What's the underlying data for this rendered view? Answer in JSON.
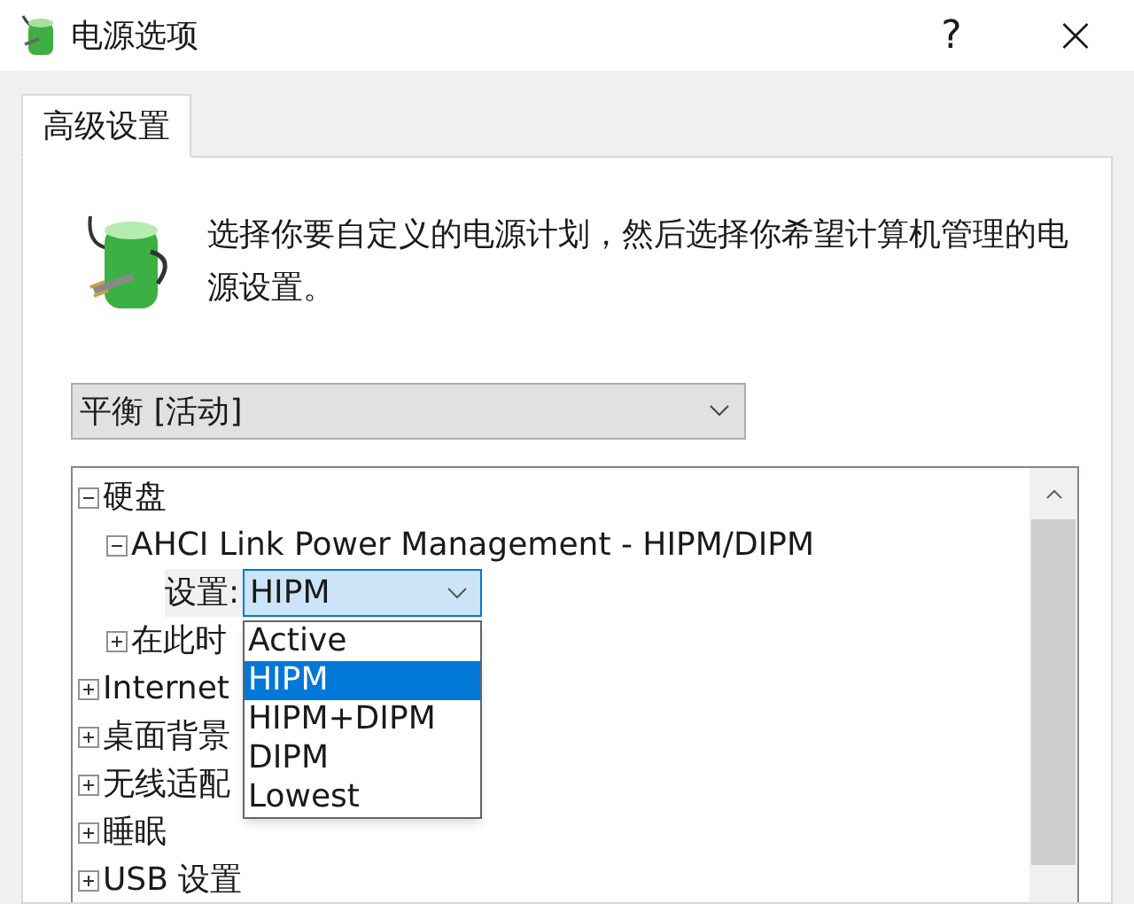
{
  "window": {
    "title": "电源选项",
    "buttons": [
      {
        "kind": "help",
        "label": "?"
      },
      {
        "kind": "close",
        "label": "×"
      }
    ]
  },
  "tabs": [
    {
      "label": "高级设置",
      "selected": true
    }
  ],
  "description": "选择你要自定义的电源计划，然后选择你希望计算机管理的电源设置。",
  "plan_dropdown": {
    "value": "平衡 [活动]"
  },
  "tree": [
    {
      "kind": "node",
      "label": "硬盘",
      "expanded": true,
      "children": [
        {
          "kind": "node",
          "label": "AHCI Link Power Management - HIPM/DIPM",
          "expanded": true,
          "children": [
            {
              "kind": "setting",
              "label": "设置:",
              "value": "HIPM",
              "open": true,
              "options": [
                {
                  "label": "Active",
                  "selected": false
                },
                {
                  "label": "HIPM",
                  "selected": true
                },
                {
                  "label": "HIPM+DIPM",
                  "selected": false
                },
                {
                  "label": "DIPM",
                  "selected": false
                },
                {
                  "label": "Lowest",
                  "selected": false
                }
              ]
            }
          ]
        },
        {
          "kind": "node",
          "label": "在此时",
          "expanded": false
        }
      ]
    },
    {
      "kind": "node",
      "label": "Internet",
      "expanded": false
    },
    {
      "kind": "node",
      "label": "桌面背景",
      "expanded": false
    },
    {
      "kind": "node",
      "label": "无线适配",
      "expanded": false
    },
    {
      "kind": "node",
      "label": "睡眠",
      "expanded": false
    },
    {
      "kind": "node",
      "label": "USB 设置",
      "expanded": false
    }
  ]
}
